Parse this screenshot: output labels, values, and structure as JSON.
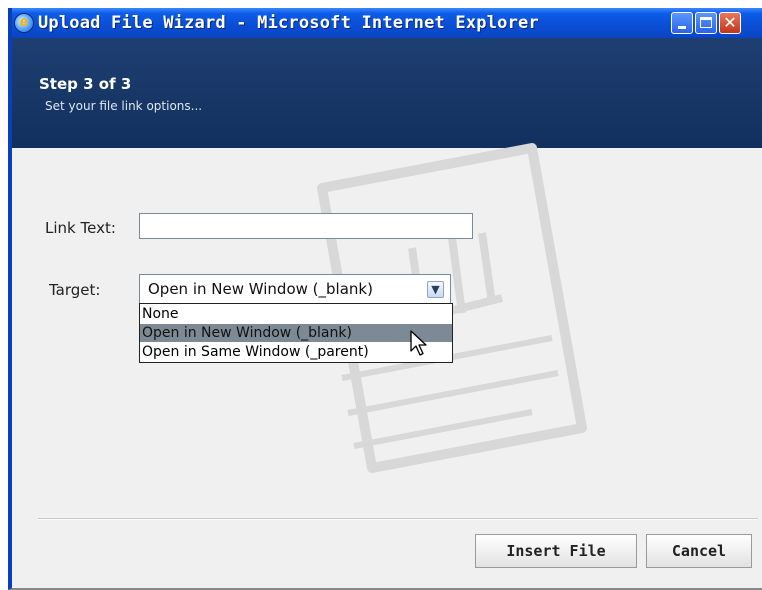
{
  "window": {
    "title": "Upload File Wizard - Microsoft Internet Explorer"
  },
  "header": {
    "step": "Step 3 of 3",
    "subtitle": "Set your file link options..."
  },
  "form": {
    "link_text_label": "Link Text:",
    "link_text_value": "",
    "target_label": "Target:",
    "target_selected": "Open in New Window (_blank)",
    "target_options": [
      "None",
      "Open in New Window (_blank)",
      "Open in Same Window (_parent)"
    ],
    "highlighted_option_index": 1
  },
  "buttons": {
    "insert": "Insert File",
    "cancel": "Cancel"
  },
  "colors": {
    "titlebar": "#0a4fd6",
    "header": "#1a3a6a",
    "highlight": "#7d8a95"
  }
}
